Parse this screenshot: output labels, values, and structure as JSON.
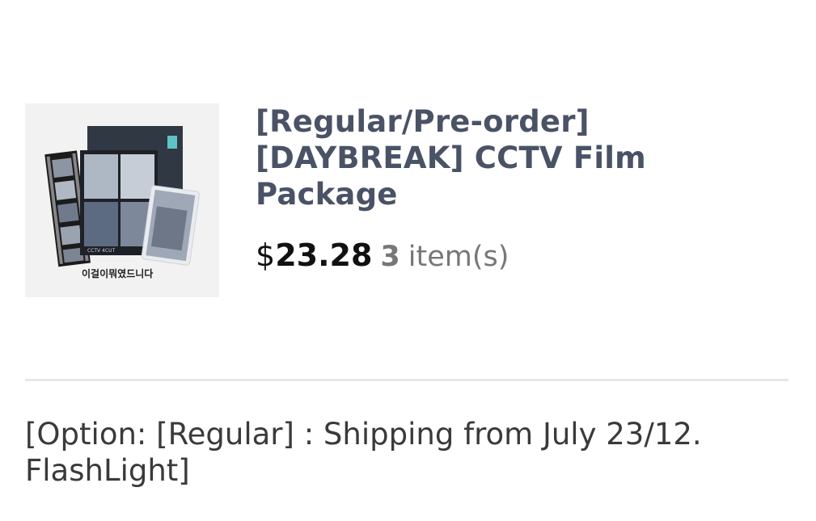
{
  "product": {
    "image_alt": "CCTV Film Package product image",
    "image_caption_left": "CCTV 4CUT",
    "image_caption_bottom": "이걸이뭐였드니다",
    "title": "[Regular/Pre-order] [DAYBREAK] CCTV Film Package",
    "currency_symbol": "$",
    "price": "23.28",
    "quantity": "3",
    "quantity_unit": "item(s)"
  },
  "option": {
    "text": "[Option: [Regular] : Shipping from July 23/12. FlashLight]"
  },
  "colors": {
    "title": "#4a5266",
    "price": "#111111",
    "muted": "#777777",
    "divider": "#e7e7e7"
  }
}
